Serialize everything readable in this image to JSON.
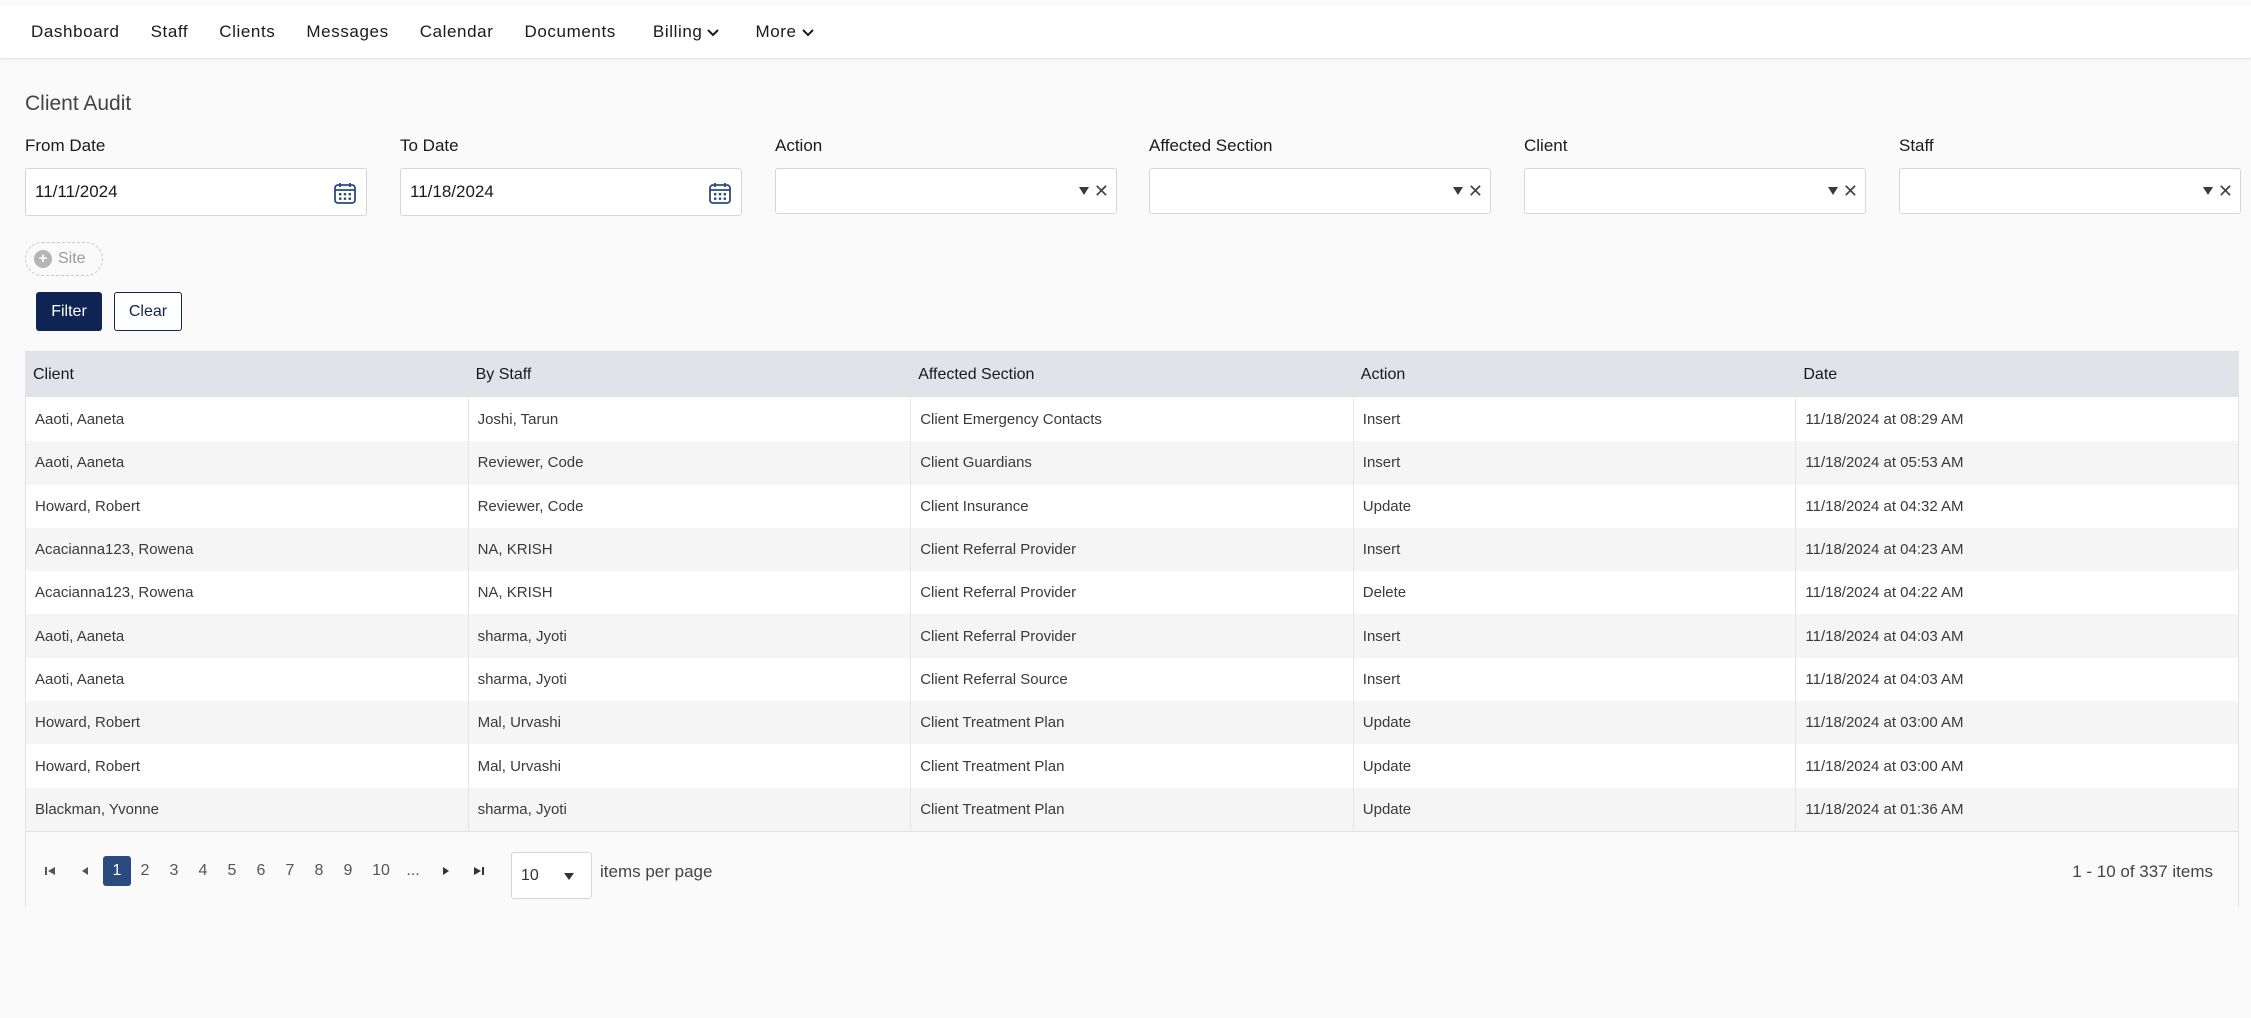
{
  "nav": {
    "items": [
      {
        "label": "Dashboard",
        "dropdown": false
      },
      {
        "label": "Staff",
        "dropdown": false
      },
      {
        "label": "Clients",
        "dropdown": false
      },
      {
        "label": "Messages",
        "dropdown": false
      },
      {
        "label": "Calendar",
        "dropdown": false
      },
      {
        "label": "Documents",
        "dropdown": false
      },
      {
        "label": "Billing",
        "dropdown": true
      },
      {
        "label": "More",
        "dropdown": true
      }
    ]
  },
  "page": {
    "title": "Client Audit"
  },
  "filters": {
    "from_date": {
      "label": "From Date",
      "value": "11/11/2024"
    },
    "to_date": {
      "label": "To Date",
      "value": "11/18/2024"
    },
    "action": {
      "label": "Action",
      "value": ""
    },
    "affected_section": {
      "label": "Affected Section",
      "value": ""
    },
    "client": {
      "label": "Client",
      "value": ""
    },
    "staff": {
      "label": "Staff",
      "value": ""
    },
    "site_chip": "Site",
    "filter_button": "Filter",
    "clear_button": "Clear"
  },
  "table": {
    "columns": [
      "Client",
      "By Staff",
      "Affected Section",
      "Action",
      "Date"
    ],
    "rows": [
      [
        "Aaoti, Aaneta",
        "Joshi, Tarun",
        "Client Emergency Contacts",
        "Insert",
        "11/18/2024 at 08:29 AM"
      ],
      [
        "Aaoti, Aaneta",
        "Reviewer, Code",
        "Client Guardians",
        "Insert",
        "11/18/2024 at 05:53 AM"
      ],
      [
        "Howard, Robert",
        "Reviewer, Code",
        "Client Insurance",
        "Update",
        "11/18/2024 at 04:32 AM"
      ],
      [
        "Acacianna123, Rowena",
        "NA, KRISH",
        "Client Referral Provider",
        "Insert",
        "11/18/2024 at 04:23 AM"
      ],
      [
        "Acacianna123, Rowena",
        "NA, KRISH",
        "Client Referral Provider",
        "Delete",
        "11/18/2024 at 04:22 AM"
      ],
      [
        "Aaoti, Aaneta",
        "sharma, Jyoti",
        "Client Referral Provider",
        "Insert",
        "11/18/2024 at 04:03 AM"
      ],
      [
        "Aaoti, Aaneta",
        "sharma, Jyoti",
        "Client Referral Source",
        "Insert",
        "11/18/2024 at 04:03 AM"
      ],
      [
        "Howard, Robert",
        "Mal, Urvashi",
        "Client Treatment Plan",
        "Update",
        "11/18/2024 at 03:00 AM"
      ],
      [
        "Howard, Robert",
        "Mal, Urvashi",
        "Client Treatment Plan",
        "Update",
        "11/18/2024 at 03:00 AM"
      ],
      [
        "Blackman, Yvonne",
        "sharma, Jyoti",
        "Client Treatment Plan",
        "Update",
        "11/18/2024 at 01:36 AM"
      ]
    ]
  },
  "pager": {
    "pages": [
      "1",
      "2",
      "3",
      "4",
      "5",
      "6",
      "7",
      "8",
      "9",
      "10",
      "..."
    ],
    "current_page": "1",
    "page_size": "10",
    "items_per_page_label": "items per page",
    "summary": "1 - 10 of 337 items"
  },
  "colors": {
    "primary": "#0f2452",
    "active_page": "#2b4a7e",
    "header_bg": "#e1e3e9"
  }
}
